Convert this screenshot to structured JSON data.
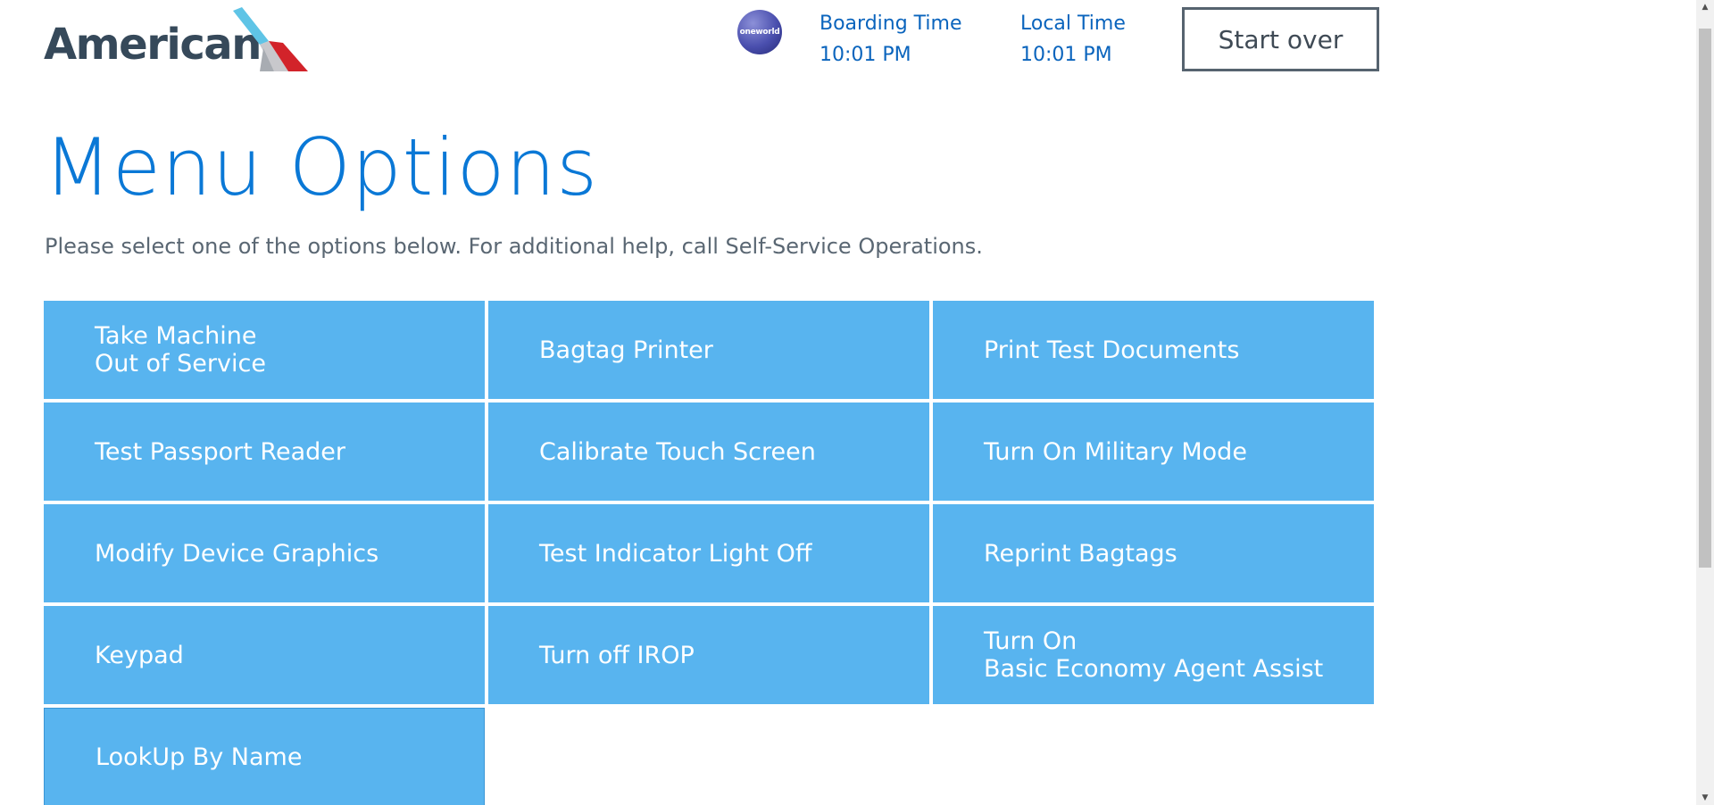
{
  "header": {
    "logo_text": "American",
    "oneworld_text": "oneworld",
    "boarding": {
      "label": "Boarding Time",
      "value": "10:01 PM"
    },
    "local": {
      "label": "Local Time",
      "value": "10:01 PM"
    },
    "start_over_label": "Start over"
  },
  "main": {
    "title": "Menu Options",
    "subtitle": "Please select one of the options below. For additional help, call Self-Service Operations.",
    "options": [
      "Take Machine\nOut of Service",
      "Bagtag Printer",
      "Print Test Documents",
      "Test Passport Reader",
      "Calibrate Touch Screen",
      "Turn On Military Mode",
      "Modify Device Graphics",
      "Test Indicator Light Off",
      "Reprint Bagtags",
      "Keypad",
      "Turn off IROP",
      "Turn On\nBasic Economy Agent Assist",
      "LookUp By Name"
    ]
  },
  "colors": {
    "brand_blue": "#0a78d6",
    "tile_blue": "#58b4ef",
    "text_gray": "#5a6773"
  },
  "icons": {
    "logo_mark": "american-flight-symbol-icon",
    "scroll_up": "arrow-up-icon",
    "scroll_down": "arrow-down-icon"
  }
}
